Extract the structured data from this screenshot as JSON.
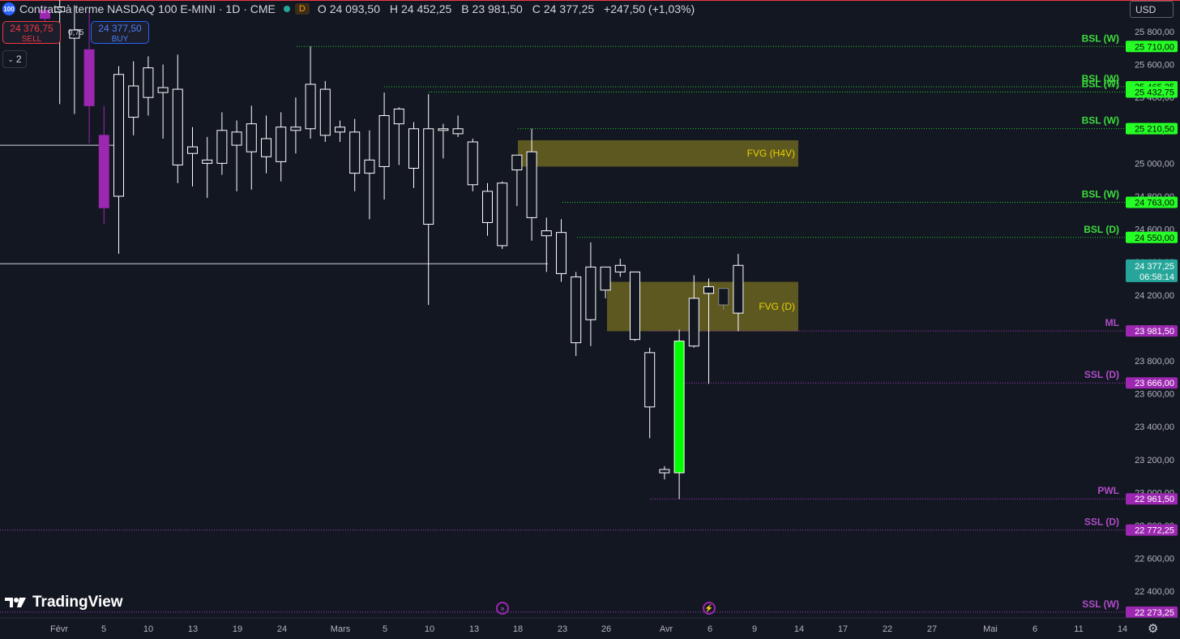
{
  "header": {
    "symbol_icon": "100",
    "title": "Contrats à terme NASDAQ 100 E-MINI · 1D · CME",
    "timeframe_badge": "D",
    "ohlc": {
      "o_label": "O",
      "o": "24 093,50",
      "h_label": "H",
      "h": "24 452,25",
      "b_label": "B",
      "b": "23 981,50",
      "c_label": "C",
      "c": "24 377,25",
      "change": "+247,50 (+1,03%)"
    }
  },
  "trade": {
    "sell_price": "24 376,75",
    "sell_label": "SELL",
    "spread": "0,75",
    "buy_price": "24 377,50",
    "buy_label": "BUY"
  },
  "collapse_label": "2",
  "currency": "USD",
  "logo_text": "TradingView",
  "colors": {
    "bg": "#131722",
    "bull": "#ffffff",
    "bear": "#ffffff",
    "green": "#26ff26",
    "purple": "#9c27b0",
    "fvg": "#8a7f1e",
    "fvg_text": "#e6d300",
    "current": "#26a69a"
  },
  "chart_data": {
    "type": "candlestick",
    "y_axis": {
      "min": 22200,
      "max": 25900,
      "ticks": [
        "25 800,00",
        "25 600,00",
        "25 400,00",
        "25 200,00",
        "25 000,00",
        "24 800,00",
        "24 600,00",
        "24 400,00",
        "24 200,00",
        "24 000,00",
        "23 800,00",
        "23 600,00",
        "23 400,00",
        "23 200,00",
        "23 000,00",
        "22 800,00",
        "22 600,00",
        "22 400,00"
      ],
      "tick_values": [
        25800,
        25600,
        25400,
        25200,
        25000,
        24800,
        24600,
        24400,
        24200,
        24000,
        23800,
        23600,
        23400,
        23200,
        23000,
        22800,
        22600,
        22400
      ]
    },
    "x_ticks": [
      "Févr",
      "5",
      "10",
      "13",
      "19",
      "24",
      "Mars",
      "5",
      "10",
      "13",
      "18",
      "23",
      "26",
      "Avr",
      "6",
      "9",
      "14",
      "17",
      "22",
      "27",
      "Mai",
      "6",
      "11",
      "14"
    ],
    "candles": [
      {
        "o": 25930,
        "h": 25960,
        "l": 25860,
        "c": 25880,
        "hl": true
      },
      {
        "o": 25950,
        "h": 26000,
        "l": 25360,
        "c": 25920
      },
      {
        "o": 25760,
        "h": 25960,
        "l": 25300,
        "c": 25810
      },
      {
        "o": 25690,
        "h": 25950,
        "l": 25120,
        "c": 25350,
        "hl": true
      },
      {
        "o": 25170,
        "h": 25350,
        "l": 24630,
        "c": 24730,
        "hl": true
      },
      {
        "o": 24800,
        "h": 25590,
        "l": 24450,
        "c": 25540
      },
      {
        "o": 25280,
        "h": 25620,
        "l": 25170,
        "c": 25470
      },
      {
        "o": 25400,
        "h": 25650,
        "l": 25290,
        "c": 25580
      },
      {
        "o": 25460,
        "h": 25600,
        "l": 25150,
        "c": 25430
      },
      {
        "o": 25450,
        "h": 25660,
        "l": 24880,
        "c": 24990
      },
      {
        "o": 25100,
        "h": 25220,
        "l": 24860,
        "c": 25060
      },
      {
        "o": 25020,
        "h": 25160,
        "l": 24790,
        "c": 25000
      },
      {
        "o": 25000,
        "h": 25310,
        "l": 24930,
        "c": 25200
      },
      {
        "o": 25110,
        "h": 25260,
        "l": 24830,
        "c": 25190
      },
      {
        "o": 25240,
        "h": 25350,
        "l": 24840,
        "c": 25070
      },
      {
        "o": 25040,
        "h": 25290,
        "l": 24940,
        "c": 25150
      },
      {
        "o": 25220,
        "h": 25310,
        "l": 24890,
        "c": 25010
      },
      {
        "o": 25220,
        "h": 25400,
        "l": 25060,
        "c": 25200
      },
      {
        "o": 25480,
        "h": 25710,
        "l": 25150,
        "c": 25210
      },
      {
        "o": 25450,
        "h": 25500,
        "l": 25130,
        "c": 25170
      },
      {
        "o": 25220,
        "h": 25260,
        "l": 25130,
        "c": 25190
      },
      {
        "o": 25190,
        "h": 25270,
        "l": 24830,
        "c": 24940
      },
      {
        "o": 24940,
        "h": 25200,
        "l": 24660,
        "c": 25020
      },
      {
        "o": 25290,
        "h": 25430,
        "l": 24780,
        "c": 24980
      },
      {
        "o": 25330,
        "h": 25340,
        "l": 24990,
        "c": 25240
      },
      {
        "o": 25210,
        "h": 25250,
        "l": 24850,
        "c": 24970
      },
      {
        "o": 24630,
        "h": 25420,
        "l": 24140,
        "c": 25210
      },
      {
        "o": 25210,
        "h": 25240,
        "l": 25030,
        "c": 25200
      },
      {
        "o": 25210,
        "h": 25290,
        "l": 25160,
        "c": 25180
      },
      {
        "o": 25130,
        "h": 25150,
        "l": 24830,
        "c": 24870
      },
      {
        "o": 24830,
        "h": 24880,
        "l": 24560,
        "c": 24640
      },
      {
        "o": 24500,
        "h": 24890,
        "l": 24480,
        "c": 24880
      },
      {
        "o": 24960,
        "h": 25050,
        "l": 24740,
        "c": 25050
      },
      {
        "o": 25070,
        "h": 25210,
        "l": 24530,
        "c": 24670
      },
      {
        "o": 24590,
        "h": 24670,
        "l": 24340,
        "c": 24560
      },
      {
        "o": 24580,
        "h": 24660,
        "l": 24280,
        "c": 24330
      },
      {
        "o": 24310,
        "h": 24340,
        "l": 23830,
        "c": 23910
      },
      {
        "o": 24050,
        "h": 24520,
        "l": 23890,
        "c": 24370
      },
      {
        "o": 24370,
        "h": 24370,
        "l": 24180,
        "c": 24230
      },
      {
        "o": 24380,
        "h": 24420,
        "l": 24310,
        "c": 24340
      },
      {
        "o": 24340,
        "h": 24340,
        "l": 23920,
        "c": 23930
      },
      {
        "o": 23850,
        "h": 23880,
        "l": 23330,
        "c": 23520
      },
      {
        "o": 23140,
        "h": 23160,
        "l": 23080,
        "c": 23120
      },
      {
        "o": 23120,
        "h": 23990,
        "l": 22960,
        "c": 23920,
        "g": true
      },
      {
        "o": 23890,
        "h": 24320,
        "l": 23880,
        "c": 24180
      },
      {
        "o": 24210,
        "h": 24300,
        "l": 23660,
        "c": 24250
      },
      {
        "o": 24240,
        "h": 24230,
        "l": 24110,
        "c": 24140,
        "dim": true
      },
      {
        "o": 24090,
        "h": 24450,
        "l": 23980,
        "c": 24380
      }
    ],
    "levels": [
      {
        "label": "BSL (W)",
        "value": 25710,
        "price": "25 710,00",
        "kind": "bsl"
      },
      {
        "label": "BSL (W)",
        "value": 25465.25,
        "price": "25 465,25",
        "kind": "bsl"
      },
      {
        "label": "BSL (W)",
        "value": 25432.75,
        "price": "25 432,75",
        "kind": "bsl"
      },
      {
        "label": "BSL (W)",
        "value": 25210.5,
        "price": "25 210,50",
        "kind": "bsl"
      },
      {
        "label": "BSL (W)",
        "value": 24763,
        "price": "24 763,00",
        "kind": "bsl"
      },
      {
        "label": "BSL (D)",
        "value": 24550,
        "price": "24 550,00",
        "kind": "bsl"
      },
      {
        "label": "ML",
        "value": 23981.5,
        "price": "23 981,50",
        "kind": "ssl"
      },
      {
        "label": "SSL (D)",
        "value": 23666,
        "price": "23 666,00",
        "kind": "ssl"
      },
      {
        "label": "PWL",
        "value": 22961.5,
        "price": "22 961,50",
        "kind": "ssl"
      },
      {
        "label": "SSL (D)",
        "value": 22772.25,
        "price": "22 772,25",
        "kind": "ssl"
      },
      {
        "label": "SSL (W)",
        "value": 22273.25,
        "price": "22 273,25",
        "kind": "ssl"
      }
    ],
    "fvg_zones": [
      {
        "label": "FVG (H4V)",
        "top": 25140,
        "bottom": 24980
      },
      {
        "label": "FVG (D)",
        "top": 24280,
        "bottom": 23980
      }
    ],
    "current_price": {
      "price": "24 377,25",
      "countdown": "06:58:14",
      "value": 24377.25
    },
    "hlines": [
      25110,
      24390
    ]
  }
}
